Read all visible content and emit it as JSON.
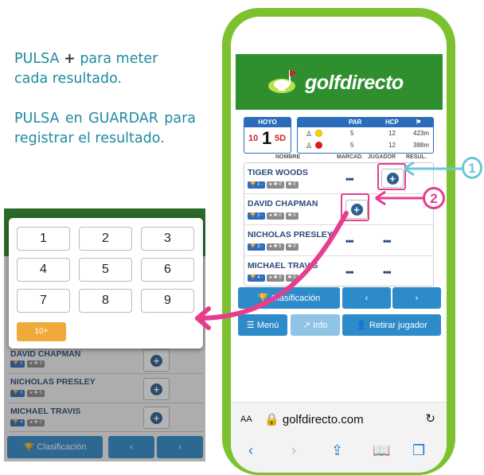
{
  "instructions": {
    "line1_pre": "PULSA ",
    "line1_plus": "+",
    "line1_post": " para meter cada resultado.",
    "line2": "PULSA en GUARDAR para registrar el resultado."
  },
  "keypad": {
    "keys": [
      "1",
      "2",
      "3",
      "4",
      "5",
      "6",
      "7",
      "8",
      "9"
    ],
    "ten_plus": "10+",
    "bg_rows": [
      {
        "name": "DAVID CHAPMAN",
        "b1": "2",
        "b2": "3"
      },
      {
        "name": "NICHOLAS PRESLEY",
        "b1": "3",
        "b2": "5"
      },
      {
        "name": "MICHAEL TRAVIS",
        "b1": "4",
        "b2": "0"
      }
    ],
    "bottom_label": "Clasificación",
    "prev": "‹",
    "next": "›"
  },
  "app": {
    "brand_prefix": "golf",
    "brand_suffix": "directo",
    "hoyo_label": "HOYO",
    "hoyo_left": "10",
    "hoyo_number": "1",
    "hoyo_right": "5D",
    "tee_headers": {
      "par": "PAR",
      "hcp": "HCP",
      "flag": "⚑"
    },
    "tees": [
      {
        "color": "#f5d800",
        "par": "5",
        "hcp": "12",
        "dist": "423m"
      },
      {
        "color": "#e3161b",
        "par": "5",
        "hcp": "12",
        "dist": "388m"
      }
    ],
    "columns": {
      "name": "NOMBRE",
      "marcad": "MARCAD.",
      "jugador": "JUGADOR",
      "resul": "RESUL."
    },
    "players": [
      {
        "name": "TIGER WOODS",
        "pos": "1",
        "b2": "0",
        "b3": "0"
      },
      {
        "name": "DAVID CHAPMAN",
        "pos": "2",
        "b2": "0",
        "b3": "0"
      },
      {
        "name": "NICHOLAS PRESLEY",
        "pos": "3",
        "b2": "5",
        "b3": "0"
      },
      {
        "name": "MICHAEL TRAVIS",
        "pos": "4",
        "b2": "9",
        "b3": "0"
      }
    ],
    "dots": "•••",
    "buttons": {
      "clasificacion": "Clasificación",
      "prev": "‹",
      "next": "›",
      "menu": "Menú",
      "info": "Info",
      "retirar": "Retirar jugador"
    }
  },
  "browser": {
    "aa": "AA",
    "url": "golfdirecto.com",
    "reload": "↻"
  },
  "callouts": {
    "one": "1",
    "two": "2"
  },
  "colors": {
    "green": "#7cc22e",
    "blue": "#2e8bc9",
    "pink": "#e63d8e",
    "cyan": "#6cc6d8"
  }
}
